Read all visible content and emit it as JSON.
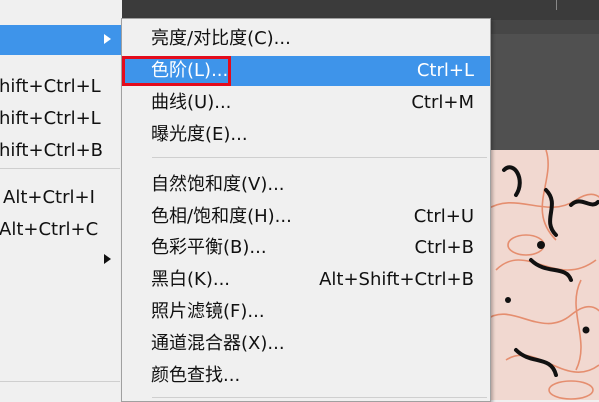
{
  "parent_menu": {
    "items": [
      {
        "label": "",
        "shortcut": ""
      },
      {
        "label": "",
        "shortcut": "hift+Ctrl+L"
      },
      {
        "label": "",
        "shortcut": "hift+Ctrl+L"
      },
      {
        "label": "",
        "shortcut": "hift+Ctrl+B"
      },
      {
        "label": "",
        "shortcut": "Alt+Ctrl+I"
      },
      {
        "label": "",
        "shortcut": "Alt+Ctrl+C"
      }
    ]
  },
  "submenu": {
    "groups": [
      [
        {
          "label": "亮度/对比度(C)...",
          "shortcut": ""
        },
        {
          "label": "色阶(L)...",
          "shortcut": "Ctrl+L"
        },
        {
          "label": "曲线(U)...",
          "shortcut": "Ctrl+M"
        },
        {
          "label": "曝光度(E)...",
          "shortcut": ""
        }
      ],
      [
        {
          "label": "自然饱和度(V)...",
          "shortcut": ""
        },
        {
          "label": "色相/饱和度(H)...",
          "shortcut": "Ctrl+U"
        },
        {
          "label": "色彩平衡(B)...",
          "shortcut": "Ctrl+B"
        },
        {
          "label": "黑白(K)...",
          "shortcut": "Alt+Shift+Ctrl+B"
        },
        {
          "label": "照片滤镜(F)...",
          "shortcut": ""
        },
        {
          "label": "通道混合器(X)...",
          "shortcut": ""
        },
        {
          "label": "颜色查找...",
          "shortcut": ""
        }
      ]
    ],
    "highlighted_item": "色阶(L)..."
  },
  "colors": {
    "highlight": "#3e94ea",
    "annotation_box": "#e30b1c",
    "menu_bg": "#f0f0f0"
  }
}
